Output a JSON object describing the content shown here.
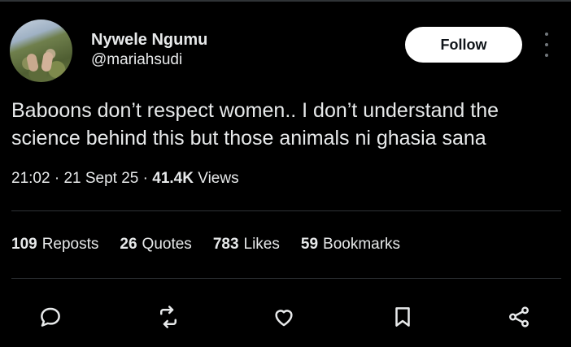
{
  "author": {
    "name": "Nywele Ngumu",
    "handle": "@mariahsudi",
    "follow_label": "Follow"
  },
  "tweet": {
    "text": "Baboons don’t respect women.. I don’t understand the science behind this but those animals ni ghasia sana",
    "time": "21:02",
    "date": "21 Sept 25",
    "views_count": "41.4K",
    "views_label": "Views"
  },
  "stats": [
    {
      "count": "109",
      "label": "Reposts"
    },
    {
      "count": "26",
      "label": "Quotes"
    },
    {
      "count": "783",
      "label": "Likes"
    },
    {
      "count": "59",
      "label": "Bookmarks"
    }
  ],
  "actions": [
    "reply-icon",
    "repost-icon",
    "like-icon",
    "bookmark-icon",
    "share-icon"
  ],
  "colors": {
    "background": "#000000",
    "text": "#e7e9ea",
    "divider": "#2f3336",
    "follow_bg": "#ffffff",
    "secondary": "#71767b"
  }
}
